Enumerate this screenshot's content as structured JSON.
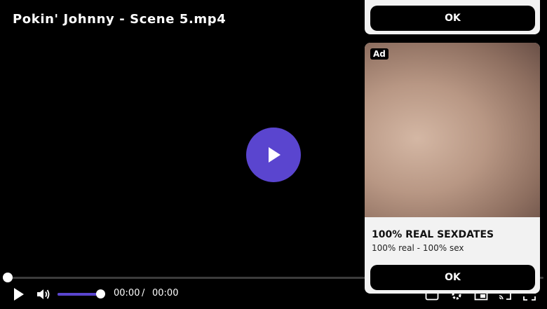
{
  "video": {
    "title": "Pokin' Johnny - Scene 5.mp4",
    "progress_fraction": 0.0,
    "volume_fraction": 1.0,
    "current_time": "00:00",
    "time_separator": "/",
    "duration": "00:00",
    "accent_color": "#5a45cf"
  },
  "controls": {
    "play_icon": "play-icon",
    "volume_icon": "volume-icon",
    "right_icons": [
      "captions-icon",
      "settings-icon",
      "picture-in-picture-icon",
      "cast-icon",
      "fullscreen-icon"
    ]
  },
  "ads": {
    "top_button_label": "OK",
    "card": {
      "badge": "Ad",
      "headline": "100% REAL SEXDATES",
      "subline": "100% real - 100% sex",
      "button_label": "OK"
    }
  }
}
